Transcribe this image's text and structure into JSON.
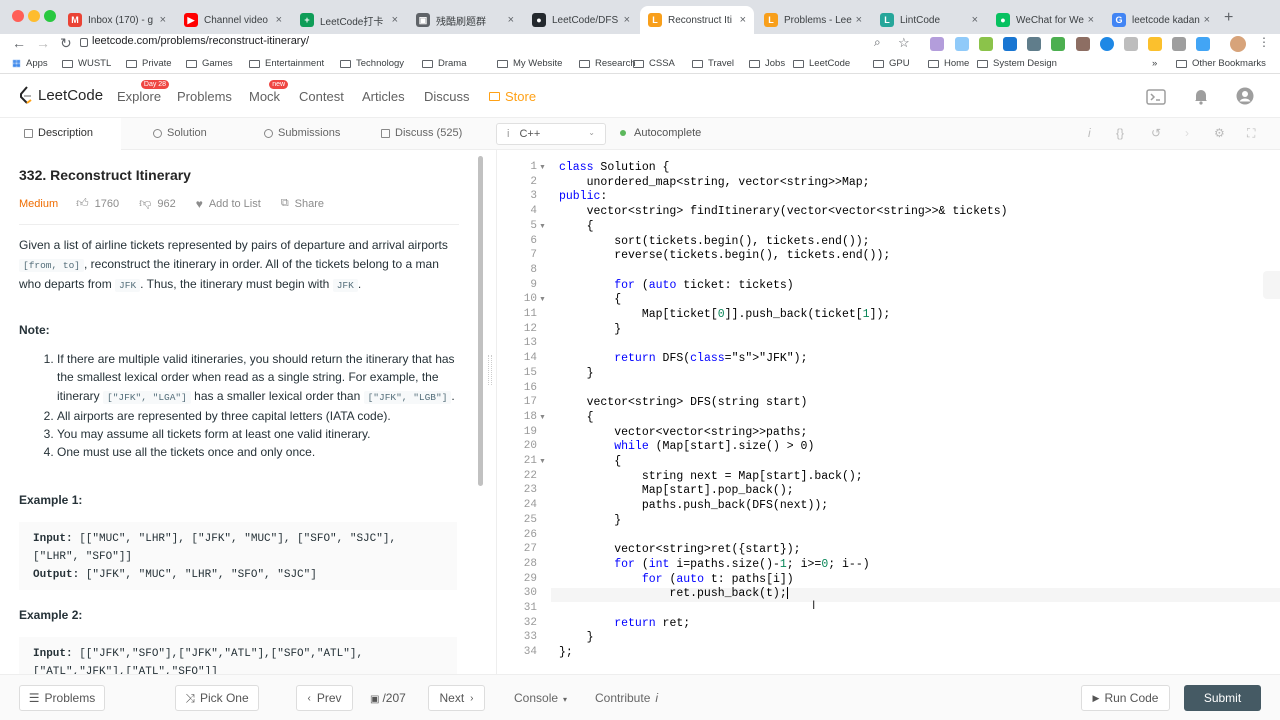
{
  "browser": {
    "tabs": [
      {
        "title": "Inbox (170) - g",
        "color": "#ea4335",
        "glyph": "M"
      },
      {
        "title": "Channel video",
        "color": "#ff0000",
        "glyph": "▶"
      },
      {
        "title": "LeetCode打卡",
        "color": "#0f9d58",
        "glyph": "+"
      },
      {
        "title": "残酷刷题群",
        "color": "#5f6368",
        "glyph": "▣"
      },
      {
        "title": "LeetCode/DFS",
        "color": "#24292e",
        "glyph": "●"
      },
      {
        "title": "Reconstruct Iti",
        "color": "#f89f1b",
        "glyph": "L"
      },
      {
        "title": "Problems - Lee",
        "color": "#f89f1b",
        "glyph": "L"
      },
      {
        "title": "LintCode",
        "color": "#26a69a",
        "glyph": "L"
      },
      {
        "title": "WeChat for We",
        "color": "#07c160",
        "glyph": "●"
      },
      {
        "title": "leetcode kadan",
        "color": "#4285f4",
        "glyph": "G"
      }
    ],
    "url": "leetcode.com/problems/reconstruct-itinerary/",
    "bookmarks": [
      "Apps",
      "WUSTL",
      "Private",
      "Games",
      "Entertainment",
      "Technology",
      "Drama",
      "My Website",
      "Research",
      "CSSA",
      "Travel",
      "Jobs",
      "LeetCode",
      "GPU",
      "Home",
      "System Design"
    ],
    "other_bookmarks": "Other Bookmarks",
    "more_bookmarks": "»"
  },
  "nav": {
    "logo": "LeetCode",
    "links": [
      "Explore",
      "Problems",
      "Mock",
      "Contest",
      "Articles",
      "Discuss",
      "Store"
    ],
    "explore_badge": "Day 28",
    "mock_badge": "new"
  },
  "subtabs": {
    "description": "Description",
    "solution": "Solution",
    "submissions": "Submissions",
    "discuss": "Discuss (525)",
    "language": "C++",
    "autocomplete": "Autocomplete"
  },
  "problem": {
    "title": "332. Reconstruct Itinerary",
    "difficulty": "Medium",
    "likes": "1760",
    "dislikes": "962",
    "add_to_list": "Add to List",
    "share": "Share",
    "desc_1": "Given a list of airline tickets represented by pairs of departure and arrival airports ",
    "desc_code_1": "[from, to]",
    "desc_2": ", reconstruct the itinerary in order. All of the tickets belong to a man who departs from ",
    "desc_code_2": "JFK",
    "desc_3": ". Thus, the itinerary must begin with ",
    "desc_code_3": "JFK",
    "desc_4": ".",
    "note_heading": "Note:",
    "note_1a": "If there are multiple valid itineraries, you should return the itinerary that has the smallest lexical order when read as a single string. For example, the itinerary ",
    "note_1_code_1": "[\"JFK\", \"LGA\"]",
    "note_1b": " has a smaller lexical order than ",
    "note_1_code_2": "[\"JFK\", \"LGB\"]",
    "note_1c": ".",
    "note_2": "All airports are represented by three capital letters (IATA code).",
    "note_3": "You may assume all tickets form at least one valid itinerary.",
    "note_4": "One must use all the tickets once and only once.",
    "example_1_heading": "Example 1:",
    "example_1_input_label": "Input:",
    "example_1_input": " [[\"MUC\", \"LHR\"], [\"JFK\", \"MUC\"], [\"SFO\", \"SJC\"], [\"LHR\", \"SFO\"]]",
    "example_1_output_label": "Output:",
    "example_1_output": " [\"JFK\", \"MUC\", \"LHR\", \"SFO\", \"SJC\"]",
    "example_2_heading": "Example 2:",
    "example_2_input_label": "Input:",
    "example_2_input": " [[\"JFK\",\"SFO\"],[\"JFK\",\"ATL\"],[\"SFO\",\"ATL\"],",
    "example_2_input_cont": "[\"ATL\",\"JFK\"],[\"ATL\",\"SFO\"]]"
  },
  "code_lines": [
    "class Solution {",
    "    unordered_map<string, vector<string>>Map;",
    "public:",
    "    vector<string> findItinerary(vector<vector<string>>& tickets)",
    "    {",
    "        sort(tickets.begin(), tickets.end());",
    "        reverse(tickets.begin(), tickets.end());",
    "",
    "        for (auto ticket: tickets)",
    "        {",
    "            Map[ticket[0]].push_back(ticket[1]);",
    "        }",
    "",
    "        return DFS(\"JFK\");",
    "    }",
    "",
    "    vector<string> DFS(string start)",
    "    {",
    "        vector<vector<string>>paths;",
    "        while (Map[start].size() > 0)",
    "        {",
    "            string next = Map[start].back();",
    "            Map[start].pop_back();",
    "            paths.push_back(DFS(next));",
    "        }",
    "",
    "        vector<string>ret({start});",
    "        for (int i=paths.size()-1; i>=0; i--)",
    "            for (auto t: paths[i])",
    "                ret.push_back(t);",
    "",
    "        return ret;",
    "    }",
    "};"
  ],
  "footer": {
    "problems": "Problems",
    "pick_one": "Pick One",
    "prev": "Prev",
    "page": "/207",
    "next": "Next",
    "console": "Console",
    "contribute": "Contribute",
    "run_code": "Run Code",
    "submit": "Submit"
  },
  "colors": {
    "accent": "#ef6c00",
    "submit_bg": "#455a64",
    "keyword": "#0000ff"
  }
}
